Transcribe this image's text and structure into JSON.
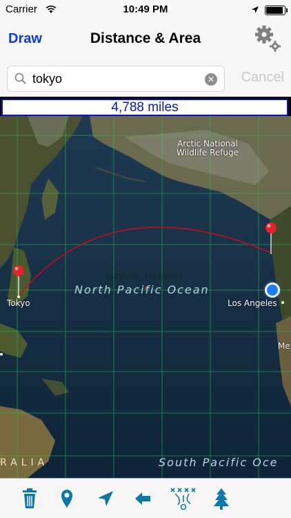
{
  "status": {
    "carrier": "Carrier",
    "time": "10:49 PM",
    "battery_level": 1.0
  },
  "nav": {
    "draw_label": "Draw",
    "title": "Distance & Area"
  },
  "search": {
    "value": "tokyo",
    "cancel_label": "Cancel"
  },
  "distance": {
    "text": "4,788 miles"
  },
  "map": {
    "ocean_north": "North Pacific Ocean",
    "ocean_south": "South Pacific Oce",
    "refuge_line1": "Arctic National",
    "refuge_line2": "Wildlife Refuge",
    "city_tokyo": "Tokyo",
    "city_la": "Los Angeles",
    "city_mex": "Mex",
    "region_australia": "RALIA",
    "midpoint_coords": "36.251388, -171.899003",
    "colors": {
      "route": "#c0101a",
      "grid": "#1ec84a",
      "pin": "#e0242a",
      "location": "#1a7cff"
    }
  },
  "toolbar": {
    "icons": [
      "trash-icon",
      "pin-icon",
      "location-arrow-icon",
      "back-arrow-icon",
      "play-diagram-icon",
      "tree-icon"
    ],
    "color": "#0a78a8"
  }
}
